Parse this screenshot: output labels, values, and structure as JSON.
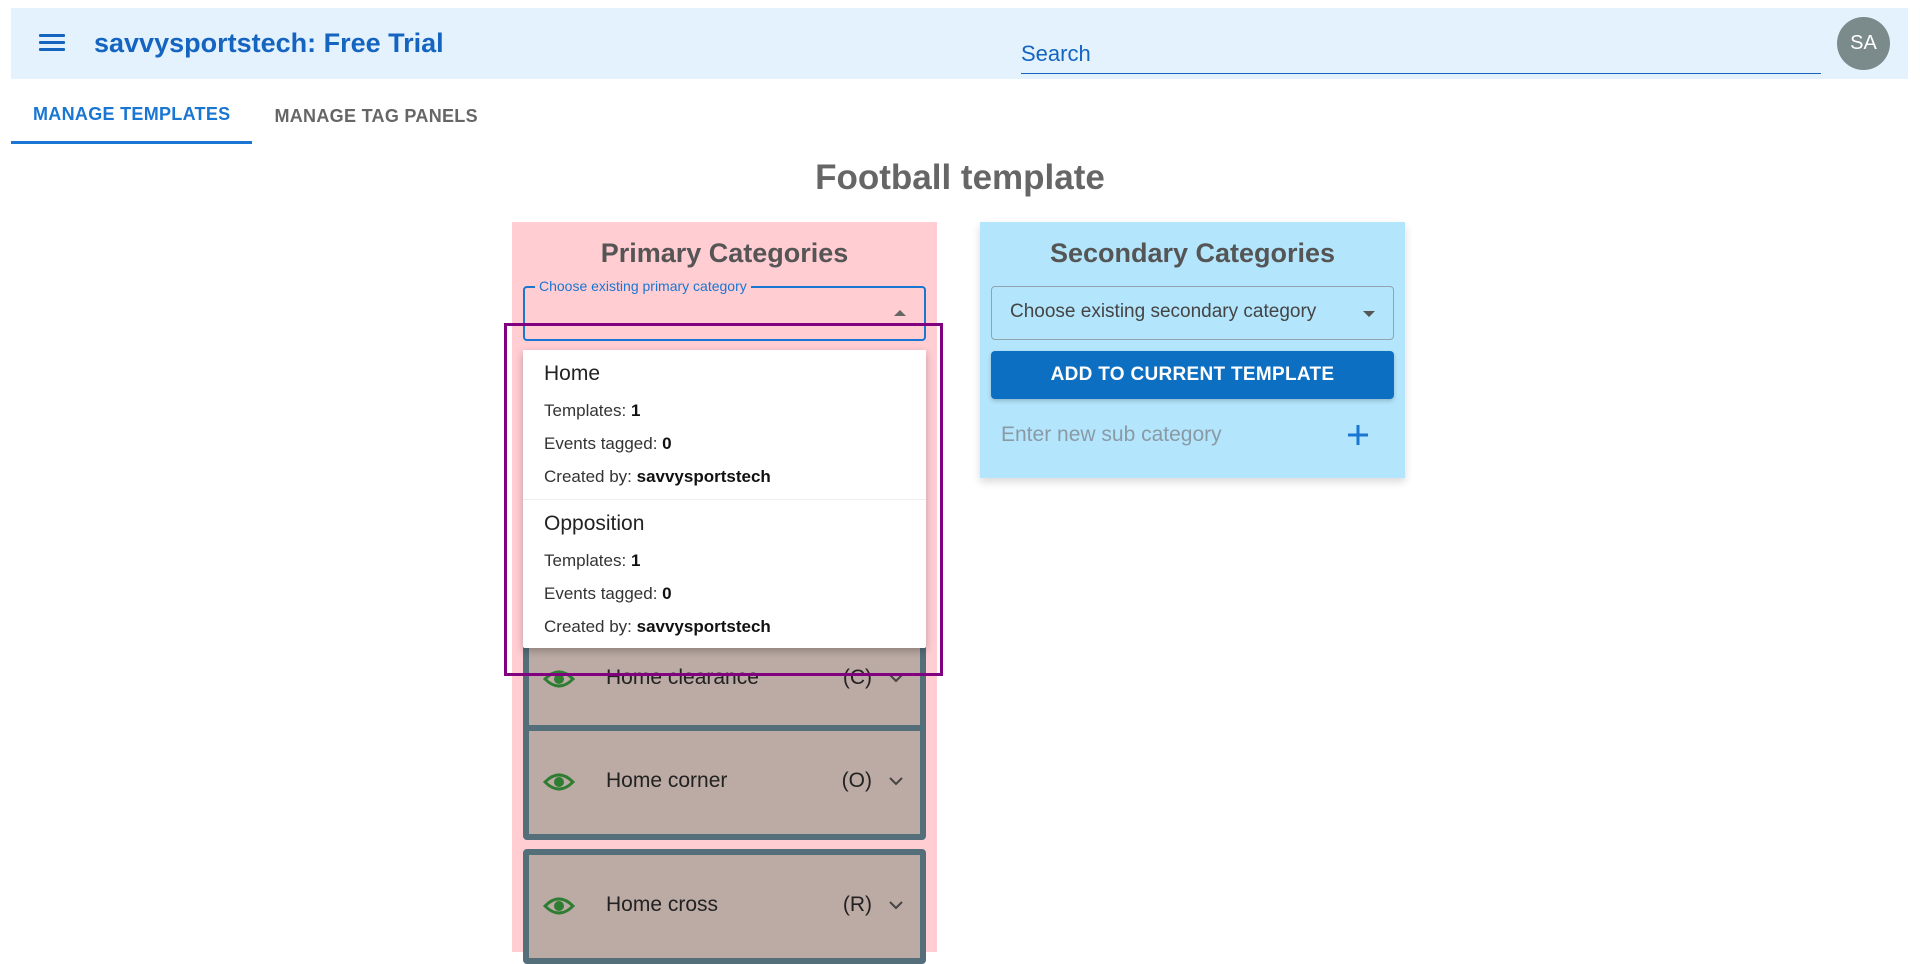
{
  "header": {
    "title": "savvysportstech: Free Trial",
    "search_placeholder": "Search",
    "avatar_initials": "SA"
  },
  "tabs": [
    {
      "label": "MANAGE TEMPLATES",
      "active": true
    },
    {
      "label": "MANAGE TAG PANELS",
      "active": false
    }
  ],
  "page_title": "Football template",
  "primary": {
    "title": "Primary Categories",
    "select_label": "Choose existing primary category",
    "options": [
      {
        "name": "Home",
        "templates_label": "Templates: ",
        "templates": "1",
        "events_label": "Events tagged: ",
        "events": "0",
        "created_label": "Created by: ",
        "created_by": "savvysportstech"
      },
      {
        "name": "Opposition",
        "templates_label": "Templates: ",
        "templates": "1",
        "events_label": "Events tagged: ",
        "events": "0",
        "created_label": "Created by: ",
        "created_by": "savvysportstech"
      }
    ],
    "categories": [
      {
        "name": "Home clearance",
        "code": "(C)"
      },
      {
        "name": "Home corner",
        "code": "(O)"
      },
      {
        "name": "Home cross",
        "code": "(R)"
      }
    ]
  },
  "secondary": {
    "title": "Secondary Categories",
    "select_value": "Choose existing secondary category",
    "add_button": "ADD TO CURRENT TEMPLATE",
    "sub_placeholder": "Enter new sub category"
  },
  "colors": {
    "accent": "#1976d2",
    "primary_panel": "#ffcdd2",
    "secondary_panel": "#b3e5fc",
    "card": "#bcaaa4",
    "eye_icon": "#2e7d32",
    "highlight": "#800080"
  }
}
